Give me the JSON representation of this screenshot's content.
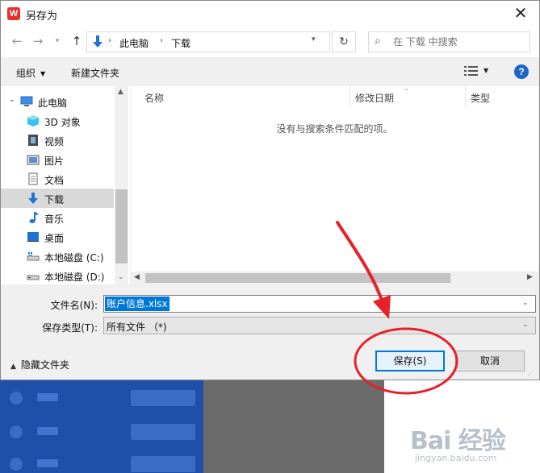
{
  "dialog": {
    "title": "另存为",
    "logo_letter": "W"
  },
  "address": {
    "crumbs": [
      "此电脑",
      "下载"
    ]
  },
  "search": {
    "placeholder": "在 下载 中搜索"
  },
  "toolbar": {
    "organize_label": "组织",
    "new_folder_label": "新建文件夹",
    "help_label": "?"
  },
  "nav": {
    "items": [
      {
        "label": "此电脑",
        "icon": "computer-icon"
      },
      {
        "label": "3D 对象",
        "icon": "cube-3d-icon"
      },
      {
        "label": "视频",
        "icon": "video-icon"
      },
      {
        "label": "图片",
        "icon": "picture-icon"
      },
      {
        "label": "文档",
        "icon": "document-icon"
      },
      {
        "label": "下载",
        "icon": "download-icon",
        "selected": true
      },
      {
        "label": "音乐",
        "icon": "music-icon"
      },
      {
        "label": "桌面",
        "icon": "desktop-icon"
      },
      {
        "label": "本地磁盘 (C:)",
        "icon": "drive-icon"
      },
      {
        "label": "本地磁盘 (D:)",
        "icon": "drive-icon"
      }
    ]
  },
  "filelist": {
    "columns": [
      "名称",
      "修改日期",
      "类型"
    ],
    "empty_message": "没有与搜索条件匹配的项。"
  },
  "form": {
    "filename_label": "文件名(N):",
    "filename_value": "账户信息.xlsx",
    "filetype_label": "保存类型(T):",
    "filetype_value": "所有文件 （*)"
  },
  "footer": {
    "hide_folders_label": "隐藏文件夹",
    "save_label": "保存(S)",
    "cancel_label": "取消"
  },
  "watermark": {
    "main": "Bai 经验",
    "sub": "jingyan.baidu.com"
  },
  "colors": {
    "accent": "#0078d7",
    "annotation_red": "#e8202a",
    "bg_blue": "#1f4fa8"
  }
}
